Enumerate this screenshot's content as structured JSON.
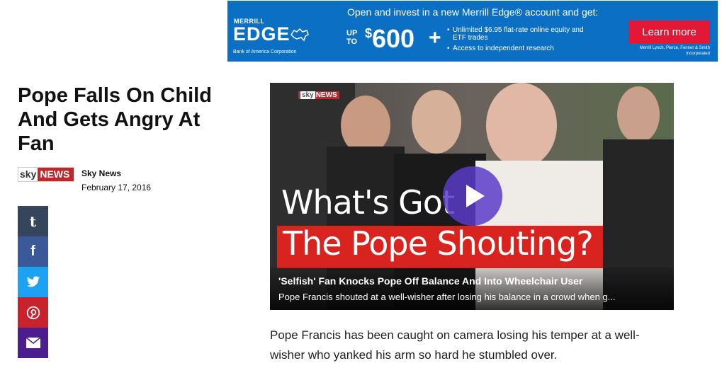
{
  "ad": {
    "brand_top": "MERRILL",
    "brand": "EDGE",
    "parent": "Bank of America Corporation",
    "headline": "Open and invest in a new Merrill Edge® account and get:",
    "up_to": "UP TO",
    "currency": "$",
    "amount": "600",
    "plus": "+",
    "bullets": [
      "Unlimited $6.95 flat-rate online equity and ETF trades",
      "Access to independent research"
    ],
    "cta_label": "Learn more",
    "legal": "Merrill Lynch, Pierce, Fenner & Smith Incorporated",
    "colors": {
      "background": "#0b6fc4",
      "cta": "#e31837"
    }
  },
  "article": {
    "title": "Pope Falls On Child And Gets Angry At Fan",
    "source_logo": {
      "sky": "sky",
      "news": "NEWS"
    },
    "source_name": "Sky News",
    "date": "February 17, 2016",
    "body": "Pope Francis has been caught on camera losing his temper at a well-wisher who yanked his arm so hard he stumbled over."
  },
  "share": {
    "tumblr": {
      "glyph": "t",
      "icon": "tumblr-icon"
    },
    "facebook": {
      "glyph": "f",
      "icon": "facebook-icon"
    },
    "twitter": {
      "icon": "twitter-icon"
    },
    "pinterest": {
      "icon": "pinterest-icon"
    },
    "email": {
      "icon": "email-icon"
    }
  },
  "video": {
    "watermark_sky": "sky",
    "watermark_news": "NEWS",
    "headline_line1": "What's Got",
    "headline_line2": "The Pope Shouting?",
    "caption_title": "'Selfish' Fan Knocks Pope Off Balance And Into Wheelchair User",
    "caption_desc": "Pope Francis shouted at a well-wisher after losing his balance in a crowd when g...",
    "colors": {
      "banner": "#d9231f",
      "play": "#5a3cc8"
    }
  }
}
